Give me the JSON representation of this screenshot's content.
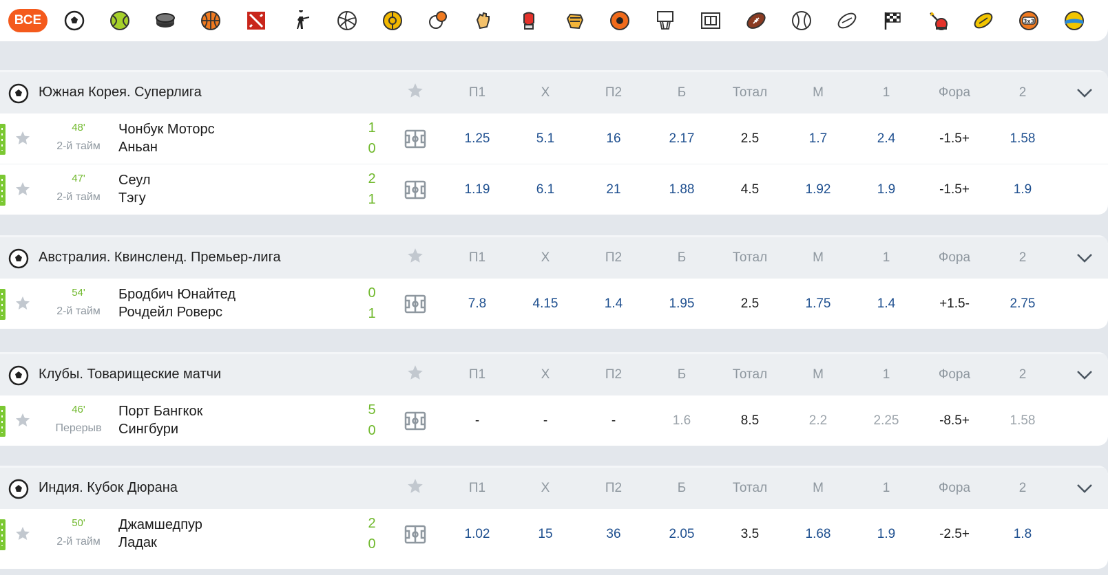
{
  "sports_bar": {
    "all_label": "ВСЕ",
    "icons": [
      "football-icon",
      "tennis-icon",
      "hockey-icon",
      "basketball-icon",
      "dota2-icon",
      "counter-strike-icon",
      "volleyball-icon",
      "futsal-icon",
      "table-tennis-icon",
      "handball-icon",
      "boxing-icon",
      "mma-icon",
      "ball-icon",
      "basketball-hoop-icon",
      "stadium-icon",
      "american-football-icon",
      "baseball-icon",
      "rugby-icon",
      "racing-flag-icon",
      "darts-icon",
      "aussie-rules-icon",
      "basketball-3x3-icon",
      "beach-volleyball-icon"
    ]
  },
  "columns": [
    "П1",
    "Х",
    "П2",
    "Б",
    "Тотал",
    "М",
    "1",
    "Фора",
    "2"
  ],
  "colors": {
    "accent": "#f45a1c",
    "live": "#6fb82b",
    "odd": "#1e4f8f",
    "muted": "#8e979f"
  },
  "leagues": [
    {
      "name": "Южная Корея. Суперлига",
      "matches": [
        {
          "minute": "48'",
          "period": "2-й тайм",
          "team1": "Чонбук Моторс",
          "team2": "Аньан",
          "score1": "1",
          "score2": "0",
          "odds": [
            "1.25",
            "5.1",
            "16",
            "2.17",
            "2.5",
            "1.7",
            "2.4",
            "-1.5+",
            "1.58"
          ]
        },
        {
          "minute": "47'",
          "period": "2-й тайм",
          "team1": "Сеул",
          "team2": "Тэгу",
          "score1": "2",
          "score2": "1",
          "odds": [
            "1.19",
            "6.1",
            "21",
            "1.88",
            "4.5",
            "1.92",
            "1.9",
            "-1.5+",
            "1.9"
          ]
        }
      ]
    },
    {
      "name": "Австралия. Квинсленд. Премьер-лига",
      "matches": [
        {
          "minute": "54'",
          "period": "2-й тайм",
          "team1": "Бродбич Юнайтед",
          "team2": "Рочдейл Роверс",
          "score1": "0",
          "score2": "1",
          "odds": [
            "7.8",
            "4.15",
            "1.4",
            "1.95",
            "2.5",
            "1.75",
            "1.4",
            "+1.5-",
            "2.75"
          ]
        }
      ]
    },
    {
      "name": "Клубы. Товарищеские матчи",
      "matches": [
        {
          "minute": "46'",
          "period": "Перерыв",
          "team1": "Порт Бангкок",
          "team2": "Сингбури",
          "score1": "5",
          "score2": "0",
          "odds": [
            "-",
            "-",
            "-",
            "1.6",
            "8.5",
            "2.2",
            "2.25",
            "-8.5+",
            "1.58"
          ]
        }
      ]
    },
    {
      "name": "Индия. Кубок Дюрана",
      "matches": [
        {
          "minute": "50'",
          "period": "2-й тайм",
          "team1": "Джамшедпур",
          "team2": "Ладак",
          "score1": "2",
          "score2": "0",
          "odds": [
            "1.02",
            "15",
            "36",
            "2.05",
            "3.5",
            "1.68",
            "1.9",
            "-2.5+",
            "1.8"
          ]
        }
      ]
    }
  ]
}
